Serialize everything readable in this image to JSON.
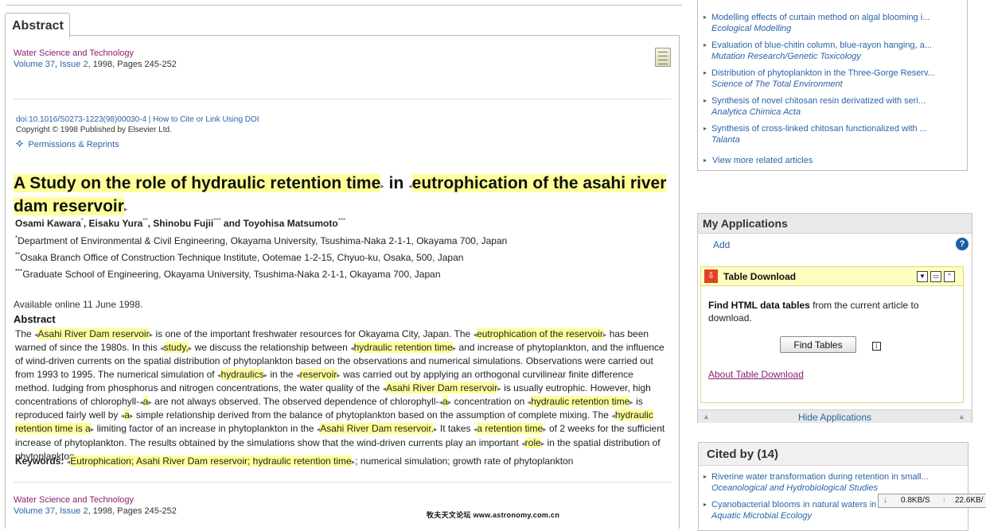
{
  "tab": {
    "label": "Abstract"
  },
  "journal": {
    "name": "Water Science and Technology",
    "volume": "Volume 37",
    "issue": "Issue 2",
    "year_pages": ", 1998, Pages 245-252",
    "comma": ","
  },
  "doi": {
    "link": "doi:10.1016/S0273-1223(98)00030-4",
    "sep": " | ",
    "cite": "How to Cite or Link Using DOI"
  },
  "copyright": "Copyright © 1998 Published by Elsevier Ltd.",
  "permissions": "Permissions & Reprints",
  "title": {
    "part1": "A Study on the role of hydraulic retention time",
    "in": " in ",
    "part2": "eutrophication of the asahi river dam reservoir",
    "mark_right": "▸",
    "mark_left": "◂"
  },
  "authors": [
    {
      "name": "Osami Kawara",
      "sup": "*",
      "sep": ", "
    },
    {
      "name": "Eisaku Yura",
      "sup": "**",
      "sep": ", "
    },
    {
      "name": "Shinobu Fujii",
      "sup": "***",
      "sep": " and "
    },
    {
      "name": "Toyohisa Matsumoto",
      "sup": "***",
      "sep": ""
    }
  ],
  "affiliations": [
    {
      "sup": "*",
      "text": "Department of Environmental & Civil Engineering, Okayama University, Tsushima-Naka 2-1-1, Okayama 700, Japan"
    },
    {
      "sup": "**",
      "text": "Osaka Branch Office of Construction Technique Institute, Ootemae 1-2-15, Chyuo-ku, Osaka, 500, Japan"
    },
    {
      "sup": "***",
      "text": "Graduate School of Engineering, Okayama University, Tsushima-Naka 2-1-1, Okayama 700, Japan"
    }
  ],
  "available": "Available online 11 June 1998.",
  "abstract_heading": "Abstract",
  "abstract_segments": [
    [
      "t",
      "The "
    ],
    [
      "h",
      "Asahi River Dam reservoir"
    ],
    [
      "t",
      " is one of the important freshwater resources for Okayama City, Japan. The "
    ],
    [
      "h",
      "eutrophication of the reservoir"
    ],
    [
      "t",
      " has been warned of since the 1980s. In this "
    ],
    [
      "h",
      "study,"
    ],
    [
      "t",
      " we discuss the relationship between "
    ],
    [
      "h",
      "hydraulic retention time"
    ],
    [
      "t",
      " and increase of phytoplankton, and the influence of wind-driven currents on the spatial distribution of phytoplankton based on the observations and numerical simulations. Observations were carried out from 1993 to 1995. The numerical simulation of "
    ],
    [
      "h",
      "hydraulics"
    ],
    [
      "t",
      " in the "
    ],
    [
      "h",
      "reservoir"
    ],
    [
      "t",
      " was carried out by applying an orthogonal curvilinear finite difference method. Iudging from phosphorus and nitrogen concentrations, the water quality of the "
    ],
    [
      "h",
      "Asahi River Dam reservoir"
    ],
    [
      "t",
      " is usually eutrophic. However, high concentrations of chlorophyll-"
    ],
    [
      "h",
      "a"
    ],
    [
      "t",
      " are not always observed. The observed dependence of chlorophyll-"
    ],
    [
      "h",
      "a"
    ],
    [
      "t",
      " concentration on "
    ],
    [
      "h",
      "hydraulic retention time"
    ],
    [
      "t",
      " is reproduced fairly well by "
    ],
    [
      "h",
      "a"
    ],
    [
      "t",
      " simple relationship derived from the balance of phytoplankton based on the assumption of complete mixing. The "
    ],
    [
      "h",
      "hydraulic retention time is a"
    ],
    [
      "t",
      " limiting factor of an increase in phytoplankton in the "
    ],
    [
      "h",
      "Asahi River Dam reservoir."
    ],
    [
      "t",
      " It takes "
    ],
    [
      "h",
      "a retention time"
    ],
    [
      "t",
      " of 2 weeks for the sufficient increase of phytoplankton. The results obtained by the simulations show that the wind-driven currents play an important "
    ],
    [
      "h",
      "role"
    ],
    [
      "t",
      " in the spatial distribution of phytoplankton."
    ]
  ],
  "keywords": {
    "label": "Keywords:",
    "highlighted": "Eutrophication; Asahi River Dam reservoir; hydraulic retention time",
    "rest": "; numerical simulation; growth rate of phytoplankton"
  },
  "footer_journal": {
    "name": "Water Science and Technology",
    "volume": "Volume 37",
    "issue": "Issue 2",
    "year_pages": ", 1998, Pages 245-252"
  },
  "related": [
    {
      "title": "Modelling effects of curtain method on algal blooming i...",
      "source": "Ecological Modelling"
    },
    {
      "title": "Evaluation of blue-chitin column, blue-rayon hanging, a...",
      "source": "Mutation Research/Genetic Toxicology"
    },
    {
      "title": "Distribution of phytoplankton in the Three-Gorge Reserv...",
      "source": "Science of The Total Environment"
    },
    {
      "title": "Synthesis of novel chitosan resin derivatized with seri...",
      "source": "Analytica Chimica Acta"
    },
    {
      "title": "Synthesis of cross-linked chitosan functionalized with ...",
      "source": "Talanta"
    }
  ],
  "view_more": "View more related articles",
  "apps": {
    "title": "My Applications",
    "add": "Add",
    "help": "?",
    "widget_title": "Table Download",
    "desc_bold": "Find HTML data tables",
    "desc_rest": " from the current article to download.",
    "find_button": "Find Tables",
    "info": "i",
    "about": "About Table Download",
    "hide": "Hide Applications"
  },
  "cited": {
    "title": "Cited by (14)",
    "items": [
      {
        "title": "Riverine water transformation during retention in small...",
        "source": "Oceanological and Hydrobiological Studies"
      },
      {
        "title": "Cyanobacterial blooms in natural waters in ...",
        "source": "Aquatic Microbial Ecology"
      }
    ]
  },
  "watermark": "牧夫天文论坛 www.astronomy.com.cn",
  "netspeed": {
    "down": "0.8KB/S",
    "up": "22.6KB/"
  },
  "colors": {
    "highlight": "#ffff99",
    "link": "#2a63a8",
    "journal": "#8a1f6e"
  }
}
